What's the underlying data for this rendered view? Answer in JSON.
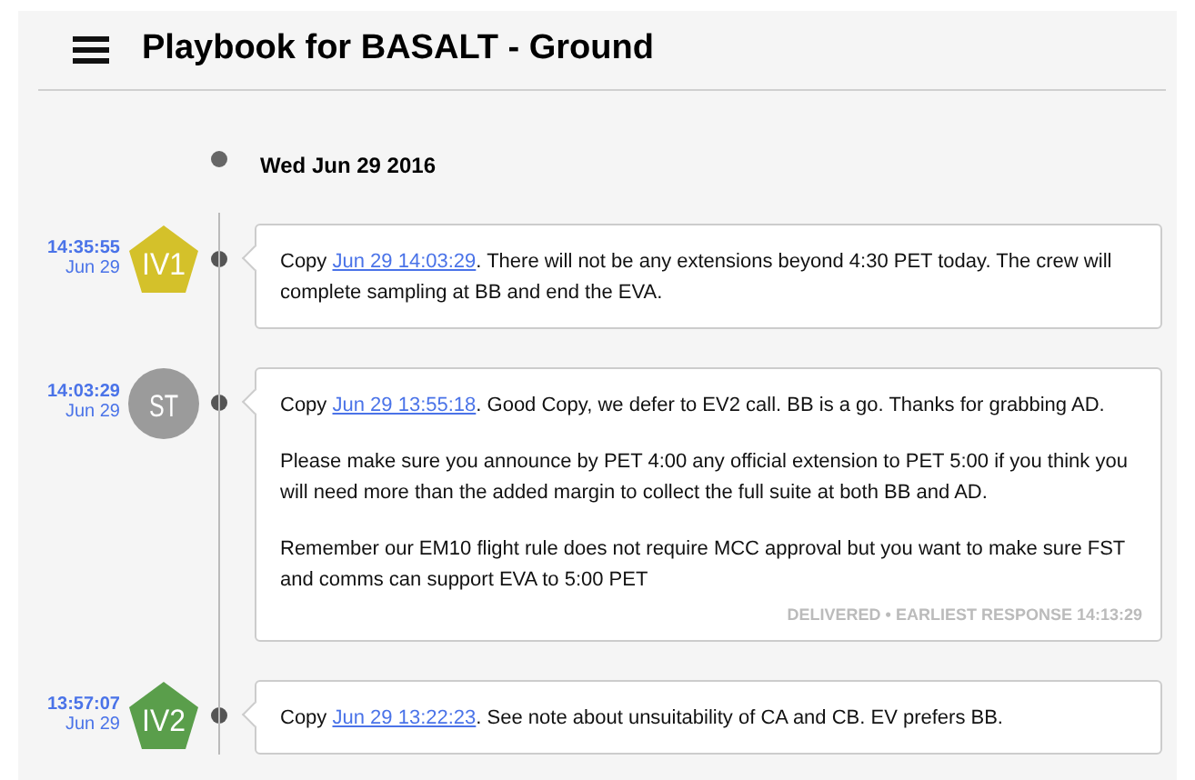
{
  "header": {
    "title": "Playbook for BASALT - Ground"
  },
  "date_heading": "Wed Jun 29 2016",
  "messages": [
    {
      "time": "14:35:55",
      "date": "Jun 29",
      "avatar": {
        "kind": "pentagon",
        "label": "IV1",
        "color": "#d4c12a"
      },
      "paragraphs": [
        {
          "before": "Copy ",
          "link": "Jun 29 14:03:29",
          "after": ". There will not be any extensions beyond 4:30 PET today. The crew will complete sampling at BB and end the EVA."
        }
      ]
    },
    {
      "time": "14:03:29",
      "date": "Jun 29",
      "avatar": {
        "kind": "circle",
        "label": "ST",
        "color": "#9b9b9b"
      },
      "paragraphs": [
        {
          "before": "Copy ",
          "link": "Jun 29 13:55:18",
          "after": ". Good Copy, we defer to EV2 call. BB is a go. Thanks for grabbing AD."
        },
        {
          "before": "Please make sure you announce by PET 4:00 any official extension to PET 5:00 if you think you will need more than the added margin to collect the full suite at both BB and AD."
        },
        {
          "before": "Remember our EM10 flight rule does not require MCC approval but you want to make sure FST and comms can support EVA to 5:00 PET"
        }
      ],
      "status": "DELIVERED • EARLIEST RESPONSE 14:13:29"
    },
    {
      "time": "13:57:07",
      "date": "Jun 29",
      "avatar": {
        "kind": "pentagon",
        "label": "IV2",
        "color": "#5a9e4b"
      },
      "paragraphs": [
        {
          "before": "Copy ",
          "link": "Jun 29 13:22:23",
          "after": ". See note about unsuitability of CA and CB. EV prefers BB."
        }
      ]
    }
  ]
}
